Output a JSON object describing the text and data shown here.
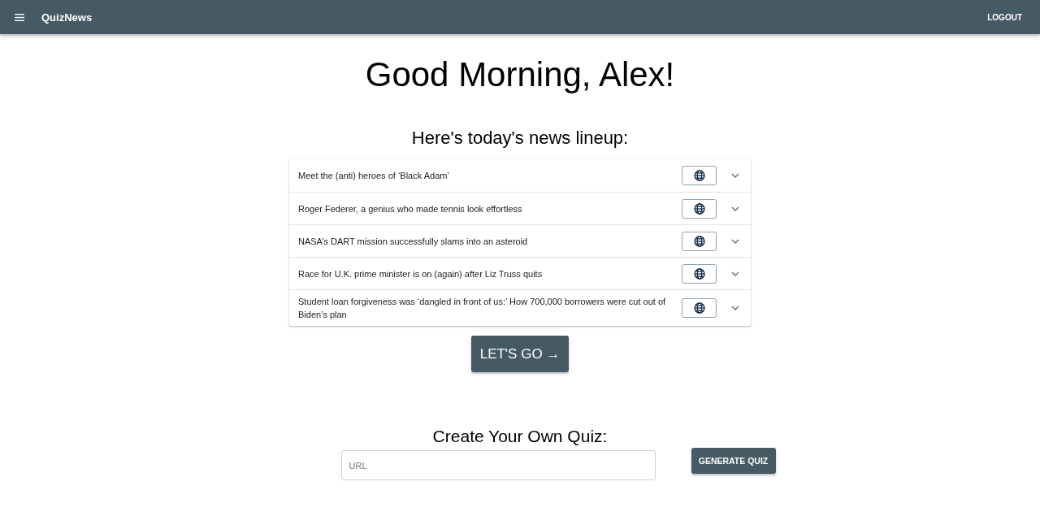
{
  "app_bar": {
    "title": "QuizNews",
    "logout": "LOGOUT"
  },
  "greeting": "Good Morning, Alex!",
  "lineup": {
    "heading": "Here's today's news lineup:",
    "articles": [
      {
        "title": "Meet the (anti) heroes of ‘Black Adam’",
        "expanded": false
      },
      {
        "title": "Roger Federer, a genius who made tennis look effortless",
        "expanded": false
      },
      {
        "title": "NASA’s DART mission successfully slams into an asteroid",
        "expanded": false
      },
      {
        "title": "Race for U.K. prime minister is on (again) after Liz Truss quits",
        "expanded": false
      },
      {
        "title": "Student loan forgiveness was ‘dangled in front of us:’ How 700,000 borrowers were cut out of Biden’s plan",
        "expanded": false
      }
    ]
  },
  "start_button": "LET'S GO →",
  "custom_quiz": {
    "heading": "Create Your Own Quiz:",
    "url_field": {
      "placeholder": "URL"
    },
    "button": "GENERATE QUIZ"
  }
}
